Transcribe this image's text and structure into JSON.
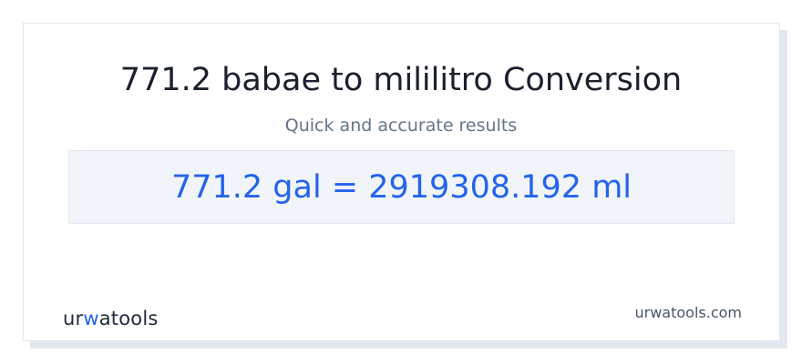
{
  "card": {
    "title": "771.2 babae to mililitro Conversion",
    "subtitle": "Quick and accurate results",
    "result": "771.2 gal = 2919308.192 ml"
  },
  "footer": {
    "logo_part1": "ur",
    "logo_part2": "w",
    "logo_part3": "atools",
    "site_url": "urwatools.com"
  },
  "colors": {
    "accent": "#2563eb",
    "title": "#1a202c",
    "muted": "#64748b",
    "result_bg": "#f1f5f9"
  }
}
